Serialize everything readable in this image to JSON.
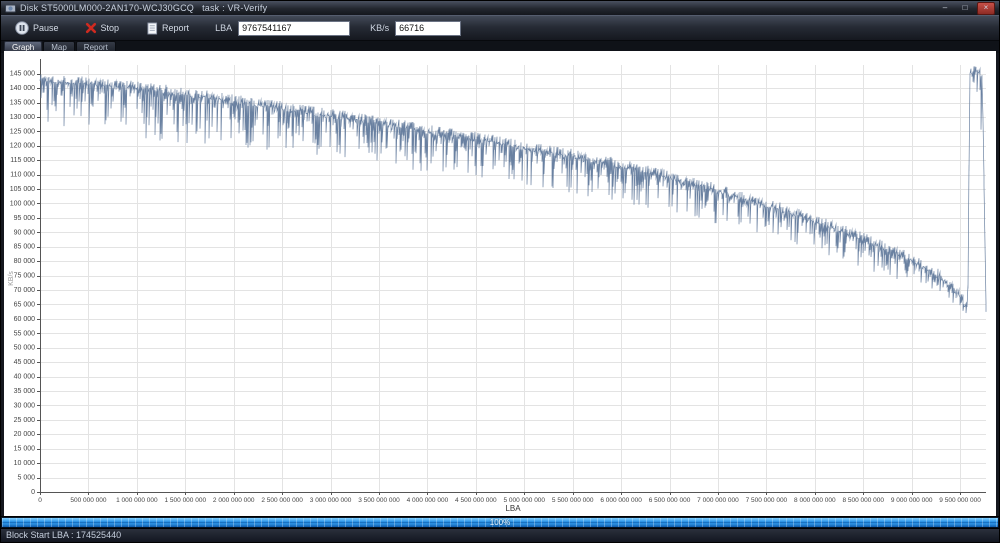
{
  "window": {
    "title": "Disk ST5000LM000-2AN170-WCJ30GCQ   task : VR-Verify",
    "buttons": {
      "minimize": "–",
      "maximize": "□",
      "close": "×"
    }
  },
  "toolbar": {
    "pause_label": "Pause",
    "stop_label": "Stop",
    "report_label": "Report",
    "lba_label": "LBA",
    "lba_value": "9767541167",
    "kbs_label": "KB/s",
    "kbs_value": "66716"
  },
  "tabs": [
    {
      "label": "Graph",
      "active": true
    },
    {
      "label": "Map",
      "active": false
    },
    {
      "label": "Report",
      "active": false
    }
  ],
  "progress": {
    "percent": "100%"
  },
  "statusbar": {
    "text": "Block Start LBA : 174525440"
  },
  "icons": {
    "app": "hdd-icon",
    "pause": "pause-circle-icon",
    "stop": "red-x-icon",
    "report": "document-icon"
  },
  "chart_data": {
    "type": "line",
    "title": "",
    "xlabel": "LBA",
    "ylabel": "KB/s",
    "xlim": [
      0,
      9767541167
    ],
    "ylim": [
      0,
      148000
    ],
    "x_tick_step": 500000000,
    "y_tick_step": 5000,
    "y_label_max": 145000,
    "grid": true,
    "legend": "none",
    "line_color": "rgba(98,122,156,0.95)",
    "grid_color": "#e3e3e3",
    "axis_color": "#555555",
    "tick_label_color": "#444444",
    "series": [
      {
        "name": "read-speed-kbs",
        "seed": 1337,
        "top_jitter": 2200,
        "anchors_x": [
          0,
          500000000,
          1000000000,
          1500000000,
          2000000000,
          2500000000,
          3000000000,
          3500000000,
          4000000000,
          4500000000,
          5000000000,
          5500000000,
          6000000000,
          6500000000,
          7000000000,
          7500000000,
          8000000000,
          8500000000,
          9000000000,
          9300000000,
          9500000000,
          9550000000,
          9580000000,
          9600000000,
          9650000000,
          9700000000,
          9730000000,
          9767541167
        ],
        "anchors_base": [
          143000,
          141500,
          140000,
          138000,
          135500,
          133000,
          130500,
          128000,
          125000,
          122500,
          119500,
          116500,
          113000,
          109000,
          104500,
          99500,
          94000,
          87500,
          80500,
          74500,
          68000,
          64500,
          64000,
          145000,
          146000,
          145500,
          143000,
          64000
        ],
        "anchors_spike_amp": [
          17000,
          17000,
          18000,
          17000,
          16000,
          16000,
          15000,
          15000,
          14000,
          14000,
          13000,
          13000,
          13000,
          12000,
          12000,
          11000,
          11000,
          10000,
          9000,
          8000,
          5000,
          2500,
          2000,
          9000,
          9000,
          9000,
          70000,
          3000
        ]
      }
    ]
  }
}
